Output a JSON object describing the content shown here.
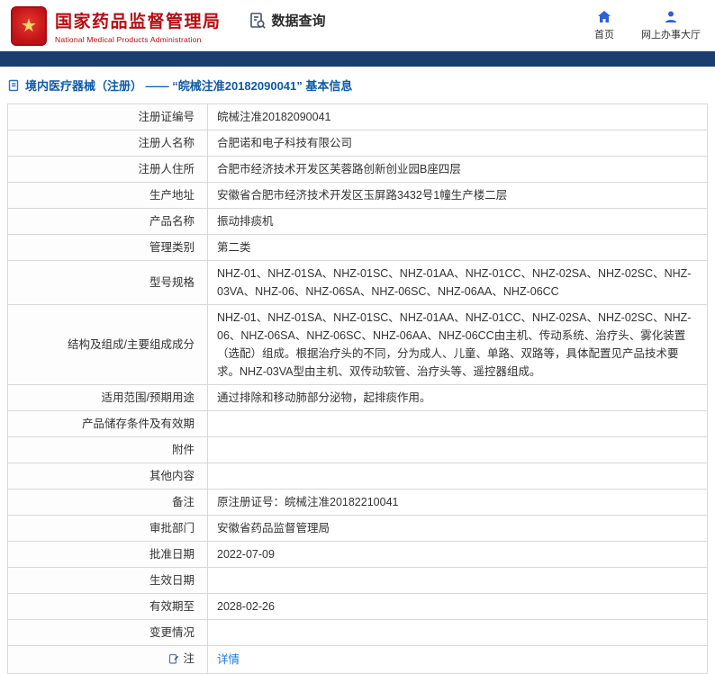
{
  "colors": {
    "brand_red": "#b50d12",
    "nav_bar_blue": "#1b3e6f",
    "breadcrumb_blue": "#0f5aa8",
    "link_blue": "#1878d8",
    "icon_blue": "#2f5fd7"
  },
  "header": {
    "org_name_cn": "国家药品监督管理局",
    "org_name_en": "National Medical Products Administration",
    "data_query_label": "数据查询",
    "nav_home_label": "首页",
    "nav_hall_label": "网上办事大厅"
  },
  "breadcrumb": {
    "text": "境内医疗器械（注册） —— “皖械注准20182090041” 基本信息"
  },
  "table": {
    "rows": [
      {
        "label": "注册证编号",
        "value": "皖械注准20182090041"
      },
      {
        "label": "注册人名称",
        "value": "合肥诺和电子科技有限公司"
      },
      {
        "label": "注册人住所",
        "value": "合肥市经济技术开发区芙蓉路创新创业园B座四层"
      },
      {
        "label": "生产地址",
        "value": "安徽省合肥市经济技术开发区玉屏路3432号1幢生产楼二层"
      },
      {
        "label": "产品名称",
        "value": "振动排痰机"
      },
      {
        "label": "管理类别",
        "value": "第二类"
      },
      {
        "label": "型号规格",
        "value": "NHZ-01、NHZ-01SA、NHZ-01SC、NHZ-01AA、NHZ-01CC、NHZ-02SA、NHZ-02SC、NHZ-03VA、NHZ-06、NHZ-06SA、NHZ-06SC、NHZ-06AA、NHZ-06CC"
      },
      {
        "label": "结构及组成/主要组成成分",
        "value": "NHZ-01、NHZ-01SA、NHZ-01SC、NHZ-01AA、NHZ-01CC、NHZ-02SA、NHZ-02SC、NHZ-06、NHZ-06SA、NHZ-06SC、NHZ-06AA、NHZ-06CC由主机、传动系统、治疗头、雾化装置（选配）组成。根据治疗头的不同，分为成人、儿童、单路、双路等，具体配置见产品技术要求。NHZ-03VA型由主机、双传动软管、治疗头等、遥控器组成。"
      },
      {
        "label": "适用范围/预期用途",
        "value": "通过排除和移动肺部分泌物，起排痰作用。"
      },
      {
        "label": "产品储存条件及有效期",
        "value": ""
      },
      {
        "label": "附件",
        "value": ""
      },
      {
        "label": "其他内容",
        "value": ""
      },
      {
        "label": "备注",
        "value": "原注册证号：皖械注准20182210041"
      },
      {
        "label": "审批部门",
        "value": "安徽省药品监督管理局"
      },
      {
        "label": "批准日期",
        "value": "2022-07-09"
      },
      {
        "label": "生效日期",
        "value": ""
      },
      {
        "label": "有效期至",
        "value": "2028-02-26"
      },
      {
        "label": "变更情况",
        "value": ""
      },
      {
        "label": "注",
        "value": "详情"
      }
    ]
  }
}
